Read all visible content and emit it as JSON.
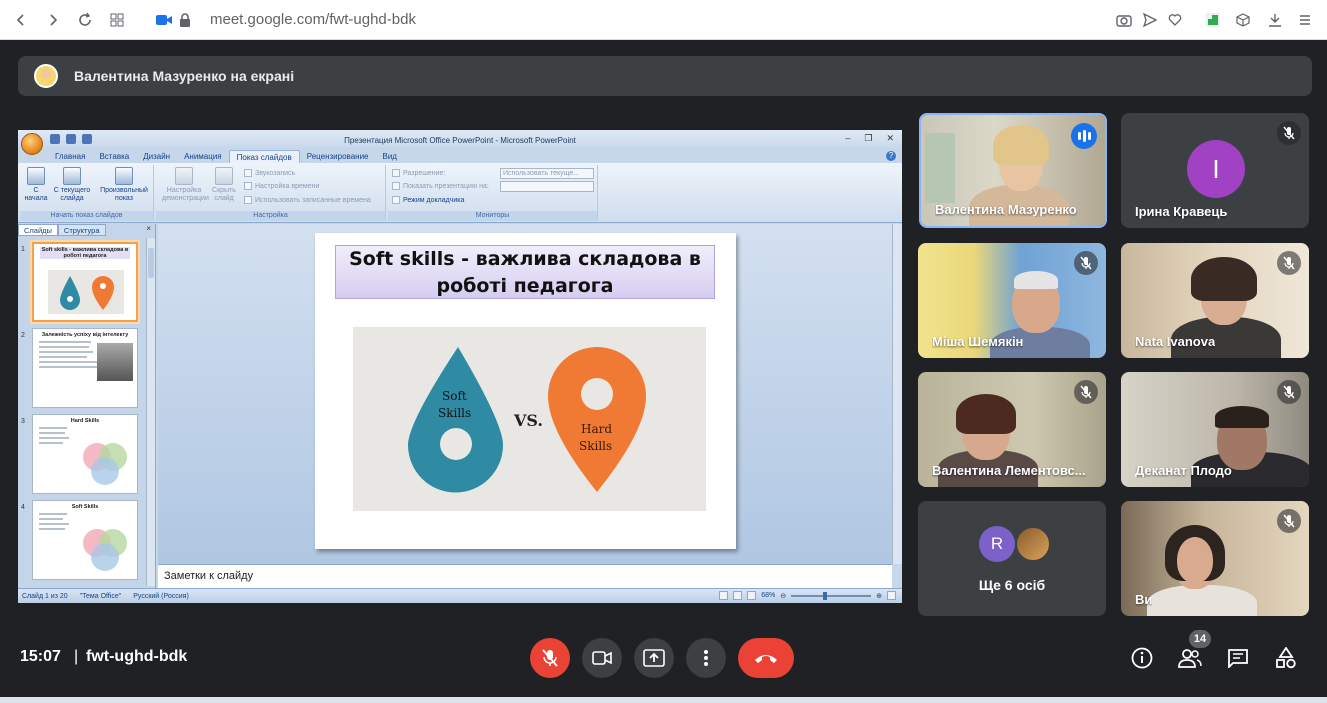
{
  "browser": {
    "url": "meet.google.com/fwt-ughd-bdk"
  },
  "banner": {
    "text": "Валентина Мазуренко на екрані"
  },
  "powerpoint": {
    "window_title": "Презентация Microsoft Office PowerPoint - Microsoft PowerPoint",
    "tabs": [
      "Главная",
      "Вставка",
      "Дизайн",
      "Анимация",
      "Показ слайдов",
      "Рецензирование",
      "Вид"
    ],
    "active_tab": "Показ слайдов",
    "ribbon": {
      "btn_from_start": "С начала",
      "btn_from_current": "С текущего слайда",
      "btn_custom": "Произвольный показ",
      "group_start": "Начать показ слайдов",
      "btn_setup": "Настройка демонстрации",
      "btn_hide": "Скрыть слайд",
      "record_narration": "Звукозапись",
      "rehearse": "Настройка времени",
      "use_timings": "Использовать записанные времена",
      "group_setup": "Настройка",
      "resolution_label": "Разрешение:",
      "resolution_value": "Использовать текуще...",
      "show_on_label": "Показать презентацию на:",
      "presenter_view": "Режим докладчика",
      "group_monitors": "Мониторы"
    },
    "pane_tabs": [
      "Слайды",
      "Структура"
    ],
    "thumbnails": [
      {
        "num": "1",
        "title": "Soft skills - важлива складова в роботі педагога"
      },
      {
        "num": "2",
        "title": "Залежність успіху від інтелекту"
      },
      {
        "num": "3",
        "title": "Hard Skills"
      },
      {
        "num": "4",
        "title": "Soft Skills"
      }
    ],
    "slide": {
      "title_line1": "Soft skills - важлива складова в",
      "title_line2": "роботі педагога",
      "drop_label_1": "Soft",
      "drop_label_2": "Skills",
      "vs": "VS.",
      "pin_label_1": "Hard",
      "pin_label_2": "Skills"
    },
    "notes_placeholder": "Заметки к слайду",
    "status": {
      "slide_info": "Слайд 1 из 20",
      "theme": "\"Тема Office\"",
      "language": "Русский (Россия)",
      "zoom": "68%"
    }
  },
  "participants": [
    {
      "name": "Валентина Мазуренко",
      "state": "speaking"
    },
    {
      "name": "Ірина Кравець",
      "avatar_letter": "І",
      "state": "muted"
    },
    {
      "name": "Міша Шемякін",
      "state": "muted"
    },
    {
      "name": "Nata Ivanova",
      "state": "muted"
    },
    {
      "name": "Валентина Лементовс...",
      "state": "muted"
    },
    {
      "name": "Деканат Плодо",
      "state": "muted"
    },
    {
      "name": "Ще 6 осіб",
      "avatar_letter": "R"
    },
    {
      "name": "Ви",
      "state": "muted"
    }
  ],
  "bottom": {
    "time": "15:07",
    "separator": "|",
    "meeting_code": "fwt-ughd-bdk",
    "participant_count": "14"
  },
  "colors": {
    "meet_bg": "#202124",
    "tile_bg": "#3c4043",
    "end_call_red": "#ea4335",
    "speaking_blue": "#1a73e8",
    "avatar_purple": "#a142c4",
    "avatar_r": "#7b61c8",
    "drop_teal": "#2f8aa4",
    "pin_orange": "#f07a34"
  }
}
